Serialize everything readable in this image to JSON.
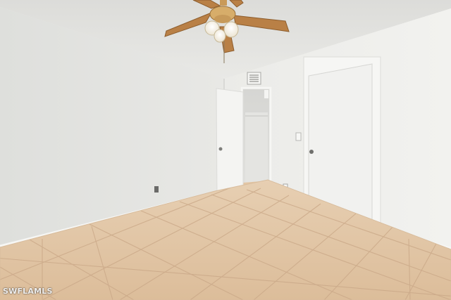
{
  "photo": {
    "scene": "empty-bedroom-with-tile-floor",
    "watermark": "SWFLAMLS"
  },
  "colors": {
    "ceiling": "#e4e4e1",
    "left_wall": "#e2e2df",
    "right_wall": "#eeeeeb",
    "door": "#f3f3f1",
    "tile": "#e3c7a6",
    "grout": "#cfb294",
    "fan_blade": "#b88045"
  }
}
